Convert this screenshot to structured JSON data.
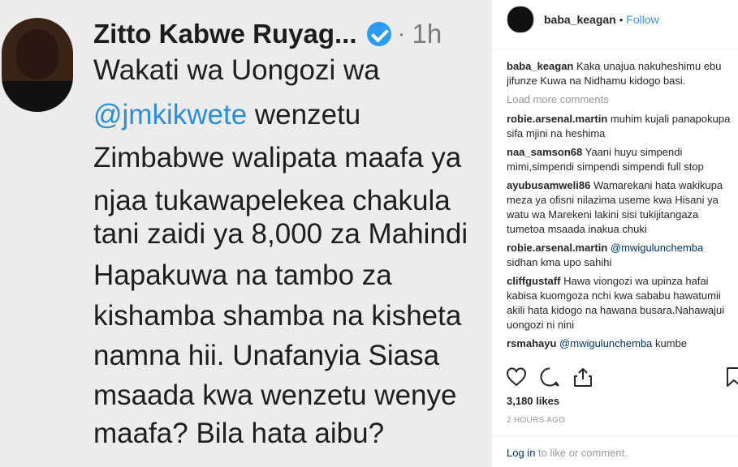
{
  "post_image": {
    "tweet_name": "Zitto Kabwe Ruyag...",
    "tweet_dot": "·",
    "tweet_time": "1h",
    "lines": [
      "Wakati wa Uongozi wa",
      " wenzetu",
      "Zimbabwe walipata maafa ya",
      "njaa tukawapelekea chakula",
      "tani zaidi ya 8,000 za Mahindi",
      "Hapakuwa na tambo za",
      "kishamba shamba na kisheta",
      "namna hii. Unafanyia Siasa",
      "msaada kwa wenzetu wenye",
      "maafa? Bila hata aibu?"
    ],
    "mention": "@jmkikwete"
  },
  "header": {
    "username": "baba_keagan",
    "separator": "•",
    "follow_label": "Follow"
  },
  "comments": {
    "caption": {
      "user": "baba_keagan",
      "text": "Kaka unajua nakuheshimu ebu jifunze Kuwa na Nidhamu kidogo basi."
    },
    "load_more": "Load more comments",
    "items": [
      {
        "user": "robie.arsenal.martin",
        "mention": "",
        "text": "muhim kujali panapokupa sifa mjini na heshima"
      },
      {
        "user": "naa_samson68",
        "mention": "",
        "text": "Yaani huyu simpendi mimi,simpendi simpendi simpendi full stop"
      },
      {
        "user": "ayubusamweli86",
        "mention": "",
        "text": "Wamarekani hata wakikupa meza ya ofisni nilazima useme kwa Hisani ya watu wa Marekeni lakini sisi tukijitangaza tumetoa msaada inakua chuki"
      },
      {
        "user": "robie.arsenal.martin",
        "mention": "@mwigulunchemba",
        "text": "sidhan kma upo sahihi"
      },
      {
        "user": "cliffgustaff",
        "mention": "",
        "text": "Hawa viongozi wa upinza hafai kabisa kuomgoza nchi kwa sababu hawatumii akili hata kidogo na hawana busara.Nahawajui uongozi ni nini"
      },
      {
        "user": "rsmahayu",
        "mention": "@mwigulunchemba",
        "text": "kumbe"
      }
    ]
  },
  "actions": {
    "icons": [
      "heart-icon",
      "comment-icon",
      "share-icon",
      "bookmark-icon"
    ]
  },
  "likes": "3,180 likes",
  "time_ago": "2 HOURS AGO",
  "login": {
    "link": "Log in",
    "text": " to like or comment."
  }
}
